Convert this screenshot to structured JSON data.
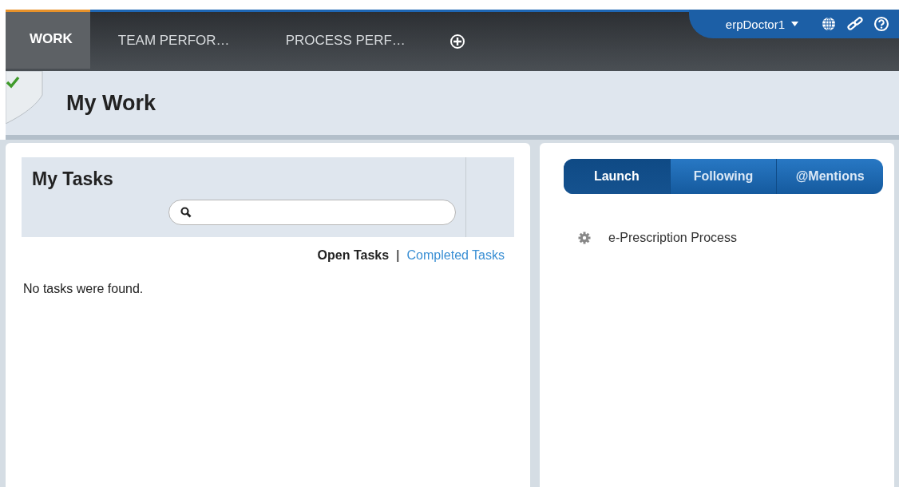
{
  "nav_tabs": [
    {
      "label": "WORK",
      "selected": true
    },
    {
      "label": "TEAM PERFOR…",
      "selected": false
    },
    {
      "label": "PROCESS PERF…",
      "selected": false
    }
  ],
  "user_menu": {
    "label": "erpDoctor1"
  },
  "page_title": "My Work",
  "tasks_panel": {
    "title": "My Tasks",
    "filters": [
      {
        "label": "Open Tasks",
        "selected": true
      },
      {
        "label": "Completed Tasks",
        "selected": false
      }
    ],
    "separator": "|",
    "empty_message": "No tasks were found."
  },
  "launch_panel": {
    "tabs": [
      {
        "label": "Launch",
        "selected": true
      },
      {
        "label": "Following",
        "selected": false
      },
      {
        "label": "@Mentions",
        "selected": false
      }
    ],
    "items": [
      {
        "label": "e-Prescription Process"
      }
    ]
  }
}
